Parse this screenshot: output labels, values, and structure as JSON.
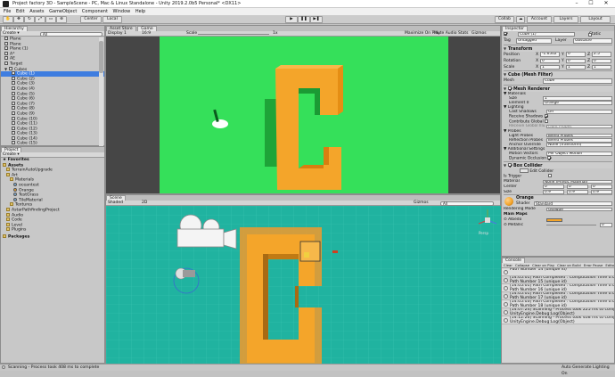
{
  "window": {
    "title": "Project factory 3D - SampleScene - PC, Mac & Linux Standalone - Unity 2019.2.0b5 Personal* <DX11>"
  },
  "menu": [
    "File",
    "Edit",
    "Assets",
    "GameObject",
    "Component",
    "Window",
    "Help"
  ],
  "toolbar": {
    "pivot_center": "Center",
    "pivot_global": "Local",
    "account": "Account",
    "layers": "Layers",
    "layout": "Layout",
    "collab": "Collab"
  },
  "hierarchy": {
    "tab": "Hierarchy",
    "create": "Create",
    "search_placeholder": "All",
    "items": [
      "Plane",
      "Plane",
      "Plane (1)",
      "A*",
      "AE",
      "Target",
      "Cubes",
      "Cube (1)",
      "Cube (2)",
      "Cube (3)",
      "Cube (4)",
      "Cube (5)",
      "Cube (6)",
      "Cube (7)",
      "Cube (8)",
      "Cube (9)",
      "Cube (10)",
      "Cube (11)",
      "Cube (12)",
      "Cube (13)",
      "Cube (14)",
      "Cube (15)"
    ]
  },
  "project": {
    "tab": "Project",
    "create": "Create",
    "tree": [
      "Favorites",
      "Assets",
      "TerrainAutoUpgrade",
      "Art",
      "Materials",
      "oceantest",
      "Orange",
      "TestGrass",
      "TileMaterial",
      "Textures",
      "AstarPathfindingProject",
      "Audio",
      "Code",
      "Level",
      "Plugins",
      "Packages"
    ]
  },
  "game_view": {
    "tabs": [
      "Asset Store",
      "Game"
    ],
    "display": "Display 1",
    "aspect": "16:9",
    "scale_label": "Scale",
    "scale_value": "1x",
    "toggles": [
      "Maximize On Play",
      "Mute Audio",
      "Stats",
      "Gizmos"
    ]
  },
  "scene_view": {
    "tab": "Scene",
    "shading": "Shaded",
    "mode_2d": "2D",
    "gizmos": "Gizmos",
    "search": "All",
    "persp": "Persp"
  },
  "inspector": {
    "tab": "Inspector",
    "object_name": "Cube (1)",
    "static_label": "Static",
    "tag_label": "Tag",
    "tag": "Untagged",
    "layer_label": "Layer",
    "layer": "Obstacle",
    "transform": {
      "title": "Transform",
      "position": [
        "-1.6502",
        "0",
        "2.5"
      ],
      "rotation": [
        "0",
        "0",
        "0"
      ],
      "scale": [
        "1",
        "1",
        "1"
      ],
      "row_labels": [
        "Position",
        "Rotation",
        "Scale"
      ]
    },
    "mesh_filter": {
      "title": "Cube (Mesh Filter)",
      "mesh_label": "Mesh",
      "mesh": "Cube"
    },
    "mesh_renderer": {
      "title": "Mesh Renderer",
      "materials": "Materials",
      "size_label": "Size",
      "size": "1",
      "element0_label": "Element 0",
      "element0": "Orange",
      "lighting": "Lighting",
      "cast_shadows_label": "Cast Shadows",
      "cast_shadows": "On",
      "receive_shadows": "Receive Shadows",
      "contribute_gi": "Contribute Global",
      "receive_gi_label": "Receive Global Illu",
      "receive_gi": "Light Probes",
      "probes": "Probes",
      "light_probes_label": "Light Probes",
      "light_probes": "Blend Probes",
      "reflection_probes_label": "Reflection Probes",
      "reflection_probes": "Blend Probes",
      "anchor_label": "Anchor Override",
      "anchor": "None (Transform)",
      "additional": "Additional Settings",
      "motion_vectors_label": "Motion Vectors",
      "motion_vectors": "Per Object Motion",
      "dynamic_occlusion": "Dynamic Occlusion"
    },
    "box_collider": {
      "title": "Box Collider",
      "edit_collider": "Edit Collider",
      "is_trigger": "Is Trigger",
      "material_label": "Material",
      "material": "None (Physic Material)",
      "center_label": "Center",
      "center": [
        "0",
        "0",
        "0"
      ],
      "size_label": "Size",
      "size": [
        "0.9",
        "0.9",
        "0.9"
      ]
    },
    "material": {
      "name": "Orange",
      "shader_label": "Shader",
      "shader": "Standard",
      "rendering_mode_label": "Rendering Mode",
      "rendering_mode": "Opaque",
      "main_maps": "Main Maps",
      "albedo": "Albedo",
      "metallic": "Metallic",
      "metallic_value": "0"
    },
    "color_orange": "#f4a52a"
  },
  "console": {
    "tab": "Console",
    "buttons": [
      "Clear",
      "Collapse",
      "Clear on Play",
      "Clear on Build",
      "Error Pause",
      "Editor"
    ],
    "counts": {
      "log": "999+",
      "warn": "0",
      "error": "0"
    },
    "lines": [
      {
        "l1": "Path Number 14 (unique id)",
        "l2": ""
      },
      {
        "l1": "[14:05:01] Path Completed : Computation Time 0.00",
        "l2": "Path Number 15 (unique id)"
      },
      {
        "l1": "[14:05:01] Path Completed : Computation Time 0.00",
        "l2": "Path Number 16 (unique id)"
      },
      {
        "l1": "[14:05:01] Path Completed : Computation Time 0.00",
        "l2": "Path Number 17 (unique id)"
      },
      {
        "l1": "[14:05:03] Path Completed : Computation Time 0.00",
        "l2": "Path Number 18 (unique id)"
      },
      {
        "l1": "[14:07:24] Scanning - Process took 225 ms to complet",
        "l2": "UnityEngine.Debug:Log(Object)"
      },
      {
        "l1": "[14:12:26] Scanning - Process took 408 ms to complet",
        "l2": "UnityEngine.Debug:Log(Object)"
      }
    ]
  },
  "status": {
    "message": "Scanning - Process took 408 ms to complete",
    "right": "Auto Generate Lighting On"
  },
  "colors": {
    "game_bg": "#35e05a",
    "scene_ground": "#20b3a0",
    "orange": "#f4a52a",
    "selection": "#3e7de0"
  }
}
